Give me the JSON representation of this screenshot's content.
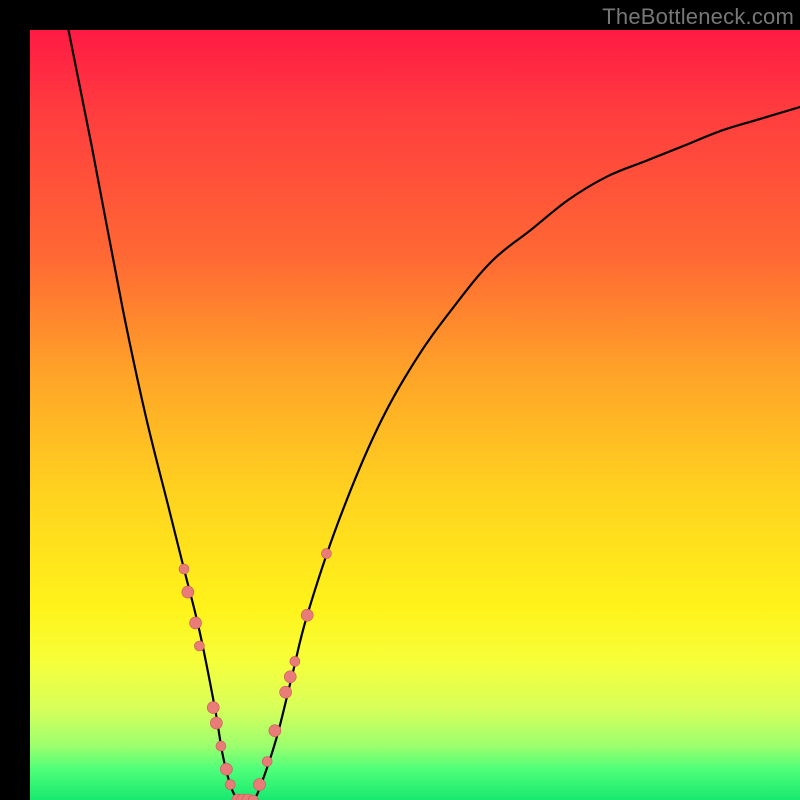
{
  "watermark": "TheBottleneck.com",
  "colors": {
    "curve": "#000000",
    "marker_fill": "#e97c78",
    "marker_stroke": "#c65a56",
    "background_black": "#000000"
  },
  "chart_data": {
    "type": "line",
    "title": "",
    "xlabel": "",
    "ylabel": "",
    "xlim": [
      0,
      100
    ],
    "ylim": [
      0,
      100
    ],
    "grid": false,
    "legend": false,
    "series": [
      {
        "name": "curve",
        "x": [
          5,
          8,
          12,
          15,
          18,
          20,
          22,
          24,
          25,
          26,
          27,
          28,
          29,
          30,
          32,
          34,
          36,
          40,
          45,
          50,
          55,
          60,
          65,
          70,
          75,
          80,
          85,
          90,
          95,
          100
        ],
        "y": [
          100,
          85,
          64,
          50,
          38,
          30,
          22,
          12,
          6,
          2,
          0,
          0,
          0,
          2,
          8,
          16,
          24,
          36,
          48,
          57,
          64,
          70,
          74,
          78,
          81,
          83,
          85,
          87,
          88.5,
          90
        ]
      }
    ],
    "markers": [
      {
        "x": 20.0,
        "y": 30,
        "r": 5
      },
      {
        "x": 20.5,
        "y": 27,
        "r": 6
      },
      {
        "x": 21.5,
        "y": 23,
        "r": 6
      },
      {
        "x": 22.0,
        "y": 20,
        "r": 5
      },
      {
        "x": 23.8,
        "y": 12,
        "r": 6
      },
      {
        "x": 24.2,
        "y": 10,
        "r": 6
      },
      {
        "x": 24.8,
        "y": 7,
        "r": 5
      },
      {
        "x": 25.5,
        "y": 4,
        "r": 6
      },
      {
        "x": 26.0,
        "y": 2,
        "r": 5
      },
      {
        "x": 27.0,
        "y": 0,
        "r": 6
      },
      {
        "x": 27.6,
        "y": 0,
        "r": 6
      },
      {
        "x": 28.3,
        "y": 0,
        "r": 6
      },
      {
        "x": 29.0,
        "y": 0,
        "r": 5
      },
      {
        "x": 29.8,
        "y": 2,
        "r": 6
      },
      {
        "x": 30.8,
        "y": 5,
        "r": 5
      },
      {
        "x": 31.8,
        "y": 9,
        "r": 6
      },
      {
        "x": 33.2,
        "y": 14,
        "r": 6
      },
      {
        "x": 33.8,
        "y": 16,
        "r": 6
      },
      {
        "x": 34.4,
        "y": 18,
        "r": 5
      },
      {
        "x": 36.0,
        "y": 24,
        "r": 6
      },
      {
        "x": 38.5,
        "y": 32,
        "r": 5
      }
    ]
  }
}
